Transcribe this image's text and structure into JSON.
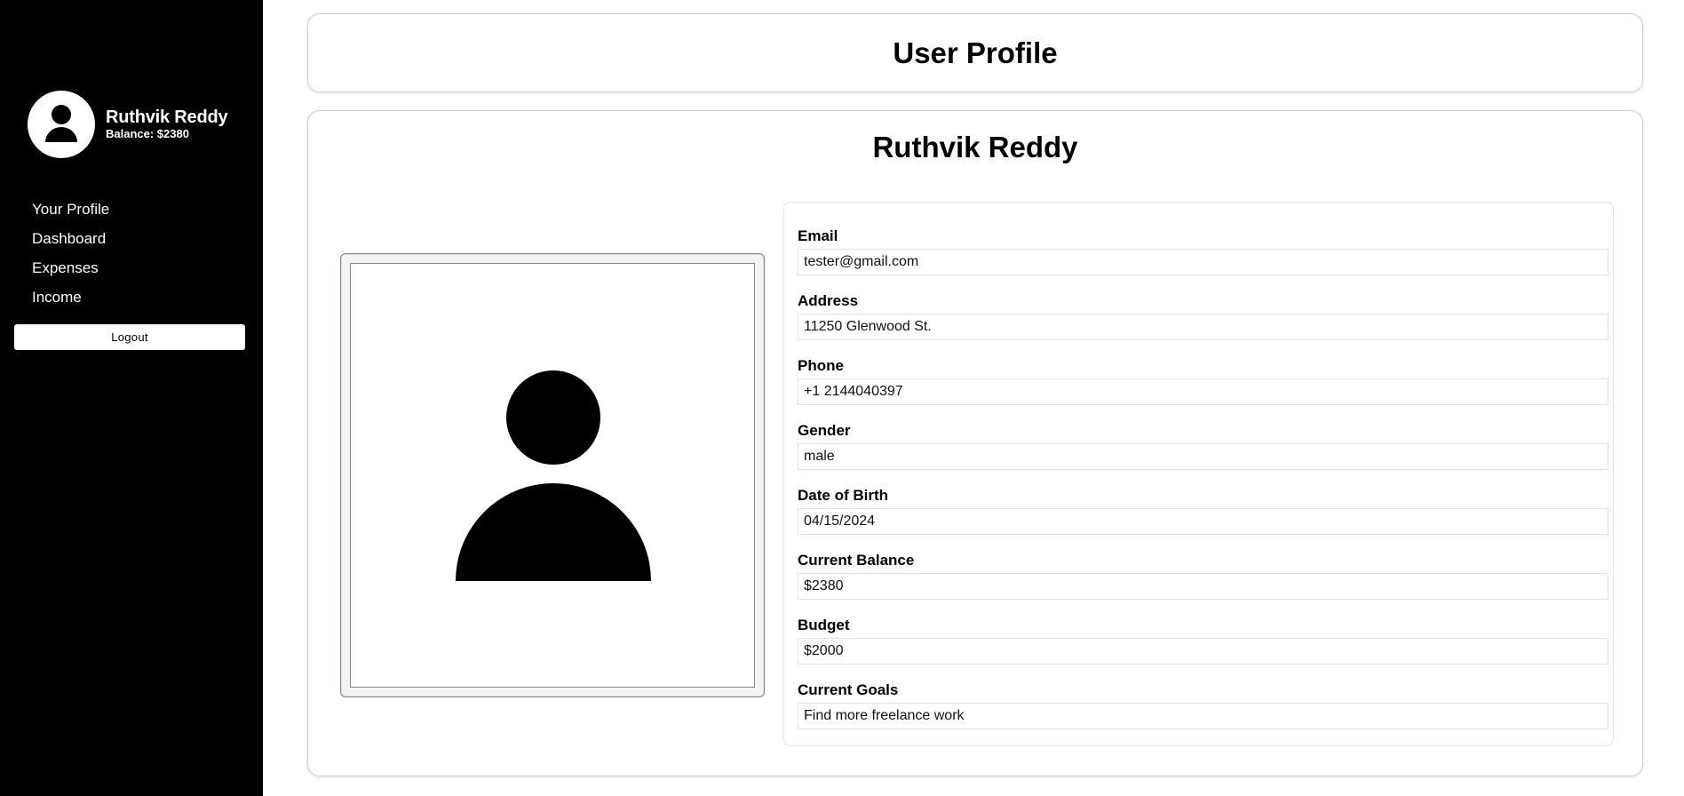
{
  "sidebar": {
    "user_name": "Ruthvik Reddy",
    "balance_text": "Balance: $2380",
    "nav": [
      "Your Profile",
      "Dashboard",
      "Expenses",
      "Income"
    ],
    "logout_label": "Logout",
    "avatar_icon": "user-avatar-icon"
  },
  "header": {
    "title": "User Profile"
  },
  "profile": {
    "name": "Ruthvik Reddy",
    "photo_icon": "user-silhouette-icon",
    "fields": [
      {
        "label": "Email",
        "value": "tester@gmail.com"
      },
      {
        "label": "Address",
        "value": "11250 Glenwood St."
      },
      {
        "label": "Phone",
        "value": "+1 2144040397"
      },
      {
        "label": "Gender",
        "value": "male"
      },
      {
        "label": "Date of Birth",
        "value": "04/15/2024"
      },
      {
        "label": "Current Balance",
        "value": "$2380"
      },
      {
        "label": "Budget",
        "value": "$2000"
      },
      {
        "label": "Current Goals",
        "value": "Find more freelance work"
      }
    ]
  },
  "colors": {
    "sidebar_bg": "#000000",
    "page_bg": "#ffffff",
    "card_border": "#cfcfcf"
  }
}
